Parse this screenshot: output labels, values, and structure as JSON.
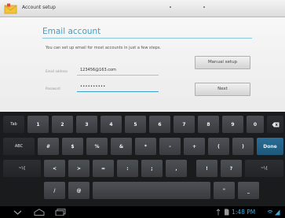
{
  "actionbar": {
    "title": "Account setup"
  },
  "form": {
    "heading": "Email account",
    "description": "You can set up email for most accounts in just a few steps.",
    "email_label": "Email address",
    "email_value": "123456@163.com",
    "password_label": "Password",
    "password_value": "••••••••••",
    "manual_setup_label": "Manual setup",
    "next_label": "Next"
  },
  "keyboard": {
    "row1": [
      "Tab",
      "1",
      "2",
      "3",
      "4",
      "5",
      "6",
      "7",
      "8",
      "9",
      "0",
      "⌫"
    ],
    "row2": [
      "ABC",
      "#",
      "$",
      "%",
      "&",
      "*",
      "-",
      "+",
      "(",
      ")",
      "Done"
    ],
    "row3": [
      "~\\{",
      "<",
      ">",
      "=",
      ":",
      ";",
      ",",
      "!",
      "?",
      "~\\{"
    ],
    "row4": [
      "/",
      "@",
      "",
      "\"",
      "_"
    ]
  },
  "system_bar": {
    "time": "1:48 PM"
  },
  "colors": {
    "accent": "#3ea0c8",
    "done_key": "#2a6d97",
    "clock": "#39a9e0"
  }
}
